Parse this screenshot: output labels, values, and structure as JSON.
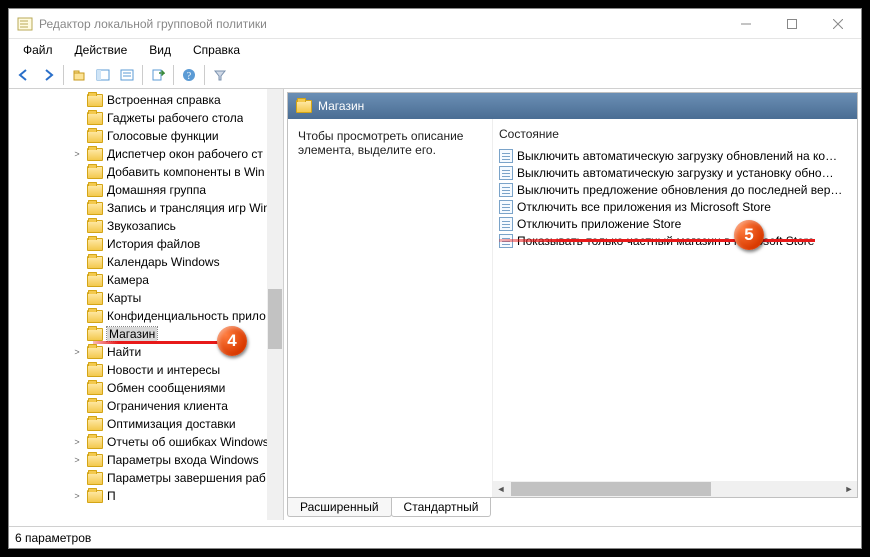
{
  "window": {
    "title": "Редактор локальной групповой политики"
  },
  "menu": {
    "items": [
      "Файл",
      "Действие",
      "Вид",
      "Справка"
    ]
  },
  "tree": {
    "items": [
      {
        "label": "Встроенная справка",
        "expandable": false
      },
      {
        "label": "Гаджеты рабочего стола",
        "expandable": false
      },
      {
        "label": "Голосовые функции",
        "expandable": false
      },
      {
        "label": "Диспетчер окон рабочего ст",
        "expandable": true
      },
      {
        "label": "Добавить компоненты в Win",
        "expandable": false
      },
      {
        "label": "Домашняя группа",
        "expandable": false
      },
      {
        "label": "Запись и трансляция игр Win",
        "expandable": false
      },
      {
        "label": "Звукозапись",
        "expandable": false
      },
      {
        "label": "История файлов",
        "expandable": false
      },
      {
        "label": "Календарь Windows",
        "expandable": false
      },
      {
        "label": "Камера",
        "expandable": false
      },
      {
        "label": "Карты",
        "expandable": false
      },
      {
        "label": "Конфиденциальность прило",
        "expandable": false
      },
      {
        "label": "Магазин",
        "expandable": false,
        "selected": true
      },
      {
        "label": "Найти",
        "expandable": true
      },
      {
        "label": "Новости и интересы",
        "expandable": false
      },
      {
        "label": "Обмен сообщениями",
        "expandable": false
      },
      {
        "label": "Ограничения клиента",
        "expandable": false
      },
      {
        "label": "Оптимизация доставки",
        "expandable": false
      },
      {
        "label": "Отчеты об ошибках Windows",
        "expandable": true
      },
      {
        "label": "Параметры входа Windows",
        "expandable": true
      },
      {
        "label": "Параметры завершения раб",
        "expandable": false
      },
      {
        "label": "П",
        "expandable": true
      }
    ]
  },
  "detail": {
    "title": "Магазин",
    "description": "Чтобы просмотреть описание элемента, выделите его.",
    "state_header": "Состояние",
    "policies": [
      "Выключить автоматическую загрузку обновлений на ко…",
      "Выключить автоматическую загрузку и установку обно…",
      "Выключить предложение обновления до последней вер…",
      "Отключить все приложения из Microsoft Store",
      "Отключить приложение Store",
      "Показывать только частный магазин в Microsoft Store"
    ]
  },
  "tabs": {
    "items": [
      "Расширенный",
      "Стандартный"
    ],
    "active": 1
  },
  "status": "6 параметров",
  "callouts": {
    "c4": "4",
    "c5": "5"
  }
}
